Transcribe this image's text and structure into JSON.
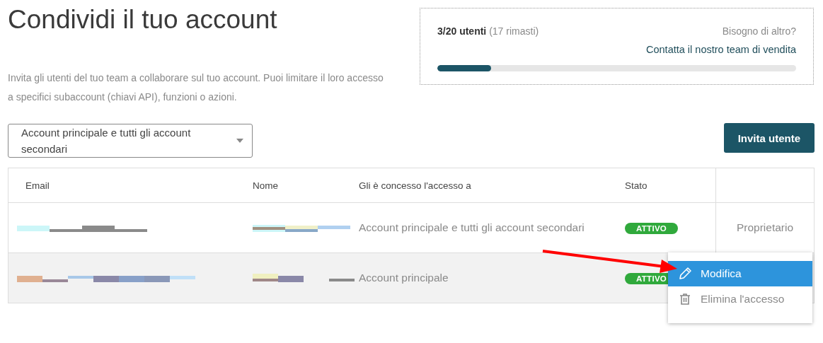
{
  "title": "Condividi il tuo account",
  "description": "Invita gli utenti del tuo team a collaborare sul tuo account. Puoi limitare il loro accesso a specifici subaccount (chiavi API), funzioni o azioni.",
  "usage": {
    "count": "3/20 utenti",
    "remaining": "(17 rimasti)",
    "help": "Bisogno di altro?",
    "link": "Contatta il nostro team di vendita",
    "level": 0.15
  },
  "account_select": {
    "value": "Account principale e tutti gli account secondari"
  },
  "invite_button": "Invita utente",
  "table": {
    "columns": [
      "Email",
      "Nome",
      "Gli è concesso l'accesso a",
      "Stato"
    ],
    "rows": [
      {
        "access": "Account principale e tutti gli account secondari",
        "status": "ATTIVO",
        "role": "Proprietario",
        "highlighted": false
      },
      {
        "access": "Account principale",
        "status": "ATTIVO",
        "highlighted": true
      }
    ]
  },
  "menu": {
    "items": [
      {
        "label": "Modifica",
        "kind": "edit",
        "selected": true
      },
      {
        "label": "Elimina l'accesso",
        "kind": "delete",
        "selected": false
      }
    ]
  }
}
